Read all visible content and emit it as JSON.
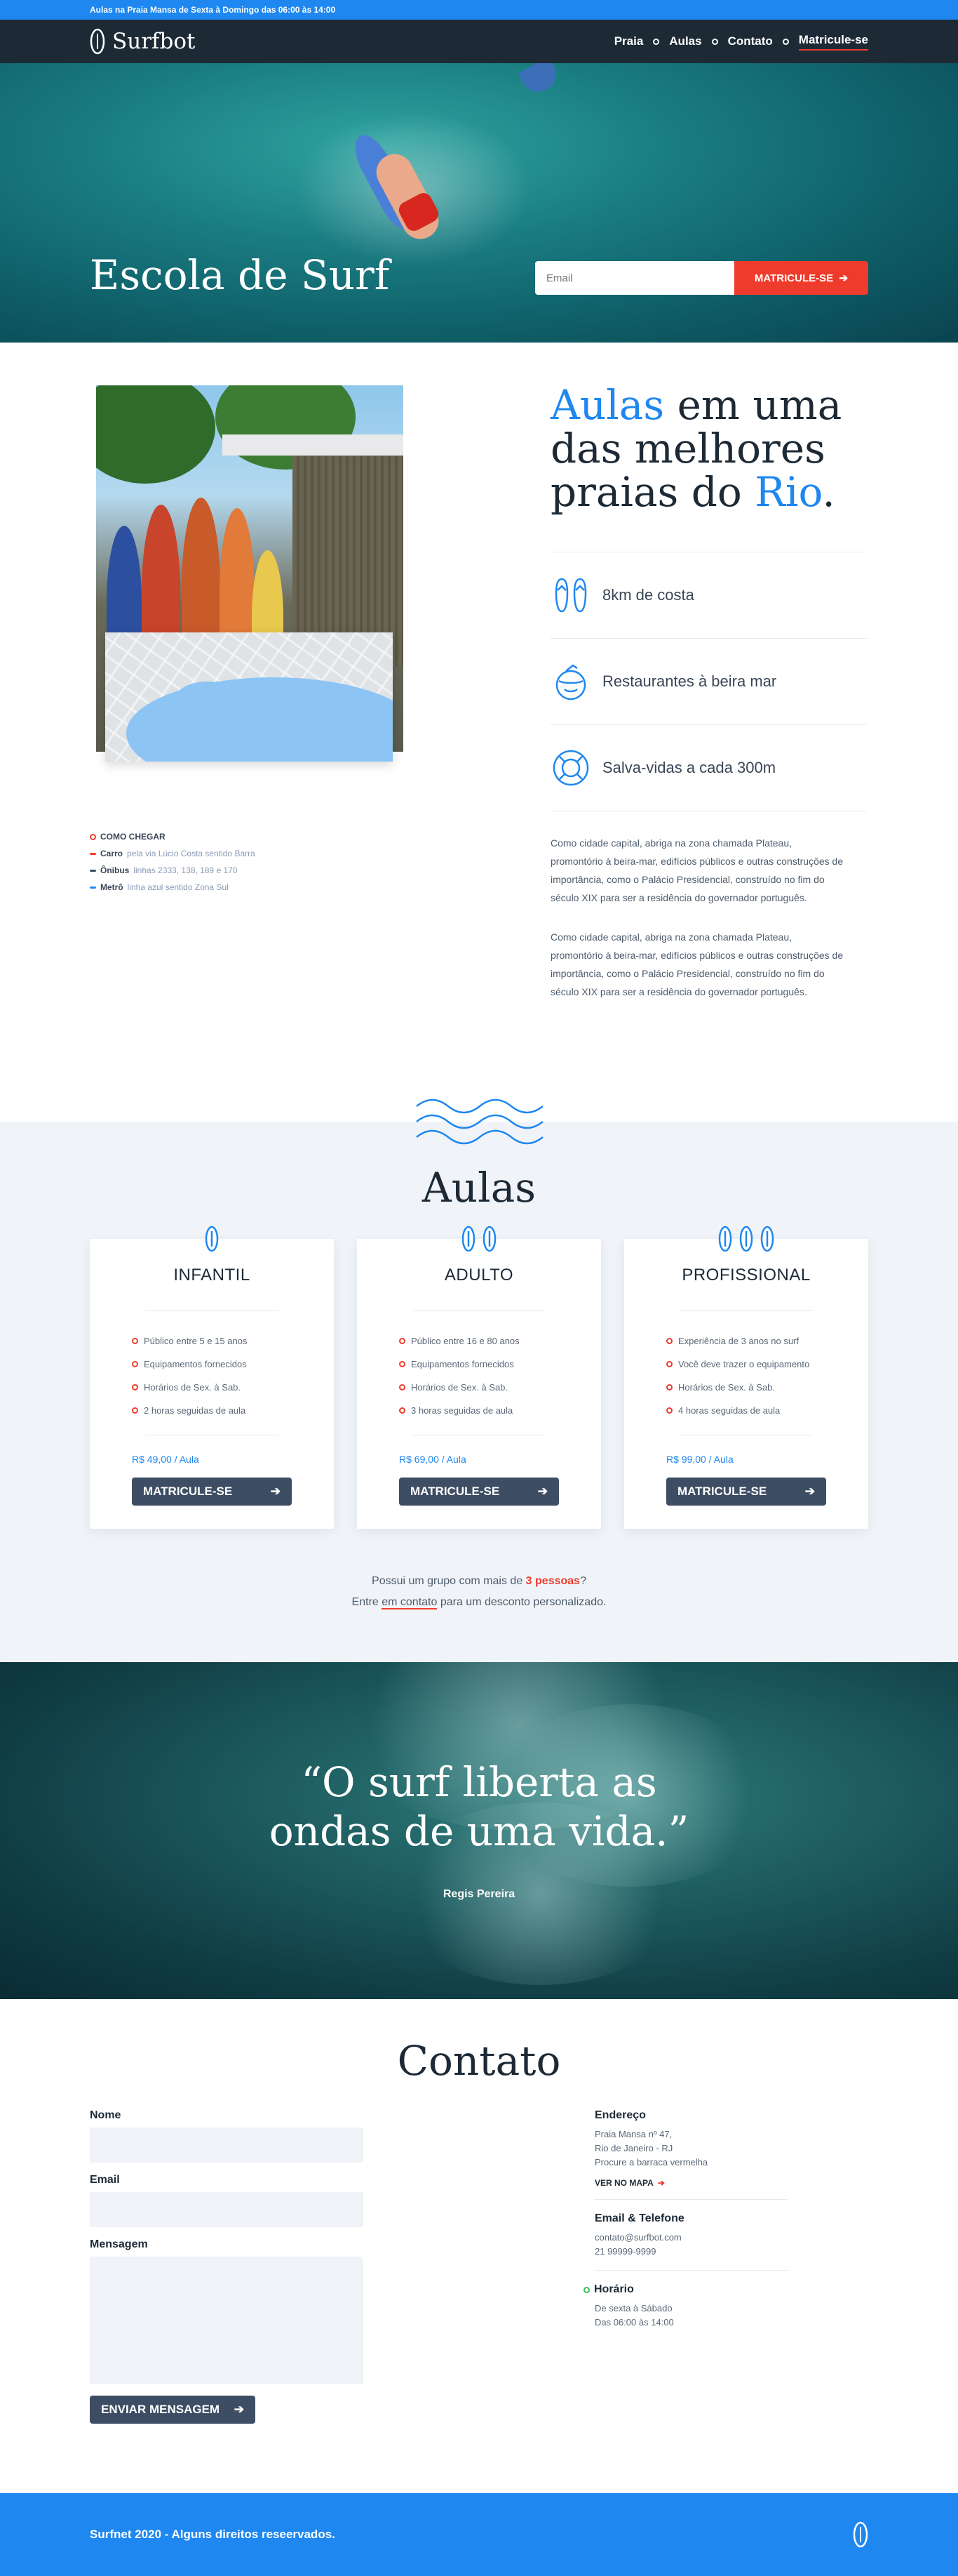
{
  "topbar": {
    "text": "Aulas na Praia Mansa de Sexta à Domingo das 06:00 às 14:00"
  },
  "nav": {
    "logo": "Surfbot",
    "items": [
      {
        "label": "Praia"
      },
      {
        "label": "Aulas"
      },
      {
        "label": "Contato"
      },
      {
        "label": "Matricule-se"
      }
    ]
  },
  "hero": {
    "title": "Escola de Surf",
    "email_placeholder": "Email",
    "cta": "MATRICULE-SE"
  },
  "beach": {
    "title_part1": "Aulas",
    "title_part2": " em uma das melhores praias do ",
    "title_part3": "Rio",
    "title_part4": ".",
    "features": [
      {
        "icon": "flip-flops-icon",
        "label": "8km de costa"
      },
      {
        "icon": "coconut-drink-icon",
        "label": "Restaurantes à beira mar"
      },
      {
        "icon": "lifebuoy-icon",
        "label": "Salva-vidas a cada 300m"
      }
    ],
    "paragraph1": "Como cidade capital, abriga na zona chamada Plateau, promontório à beira-mar, edifícios públicos e outras construções de importância, como o Palácio Presidencial, construído no fim do século XIX para ser a residência do governador português.",
    "paragraph2": "Como cidade capital, abriga na zona chamada Plateau, promontório à beira-mar, edifícios públicos e outras construções de importância, como o Palácio Presidencial, construído no fim do século XIX para ser a residência do governador português.",
    "directions": {
      "heading": "COMO CHEGAR",
      "items": [
        {
          "mode": "Carro",
          "detail": "pela via Lúcio Costa sentido Barra",
          "color": "#ef3b2c"
        },
        {
          "mode": "Ônibus",
          "detail": "linhas 2333, 138, 189 e 170",
          "color": "#3d4d63"
        },
        {
          "mode": "Metrô",
          "detail": "linha azul sentido Zona Sul",
          "color": "#1e87f0"
        }
      ]
    }
  },
  "classes": {
    "title": "Aulas",
    "cards": [
      {
        "name": "INFANTIL",
        "boards": 1,
        "items": [
          "Público entre 5 e 15 anos",
          "Equipamentos fornecidos",
          "Horários de Sex. à Sab.",
          "2 horas seguidas de aula"
        ],
        "price": "R$ 49,00 / Aula",
        "cta": "MATRICULE-SE"
      },
      {
        "name": "ADULTO",
        "boards": 2,
        "items": [
          "Público entre 16 e 80 anos",
          "Equipamentos fornecidos",
          "Horários de Sex. à Sab.",
          "3 horas seguidas de aula"
        ],
        "price": "R$ 69,00 / Aula",
        "cta": "MATRICULE-SE"
      },
      {
        "name": "PROFISSIONAL",
        "boards": 3,
        "items": [
          "Experiência de 3 anos no surf",
          "Você deve trazer o equipamento",
          "Horários de Sex. à Sab.",
          "4 horas seguidas de aula"
        ],
        "price": "R$ 99,00 / Aula",
        "cta": "MATRICULE-SE"
      }
    ],
    "group_line1_pre": "Possui um grupo com mais de ",
    "group_highlight": "3 pessoas",
    "group_line1_post": "?",
    "group_line2_pre": "Entre ",
    "group_link": "em contato",
    "group_line2_post": " para um desconto personalizado."
  },
  "quote": {
    "text_line1": "“O surf liberta as",
    "text_line2": "ondas de uma vida.”",
    "author": "Regis Pereira"
  },
  "contact": {
    "title": "Contato",
    "name_label": "Nome",
    "email_label": "Email",
    "message_label": "Mensagem",
    "submit": "ENVIAR MENSAGEM",
    "address_title": "Endereço",
    "address_lines": [
      "Praia Mansa nº 47,",
      "Rio de Janeiro - RJ",
      "Procure a barraca vermelha"
    ],
    "map_link": "VER NO MAPA",
    "email_phone_title": "Email & Telefone",
    "email": "contato@surfbot.com",
    "phone": "21 99999-9999",
    "hours_title": "Horário",
    "hours_lines": [
      "De sexta à Sábado",
      "Das 06:00 às 14:00"
    ]
  },
  "footer": {
    "text": "Surfnet 2020 - Alguns direitos reseervados."
  },
  "colors": {
    "primary": "#1e87f0",
    "accent": "#ef3b2c",
    "dark": "#1d2a36",
    "button": "#3d4d63"
  }
}
